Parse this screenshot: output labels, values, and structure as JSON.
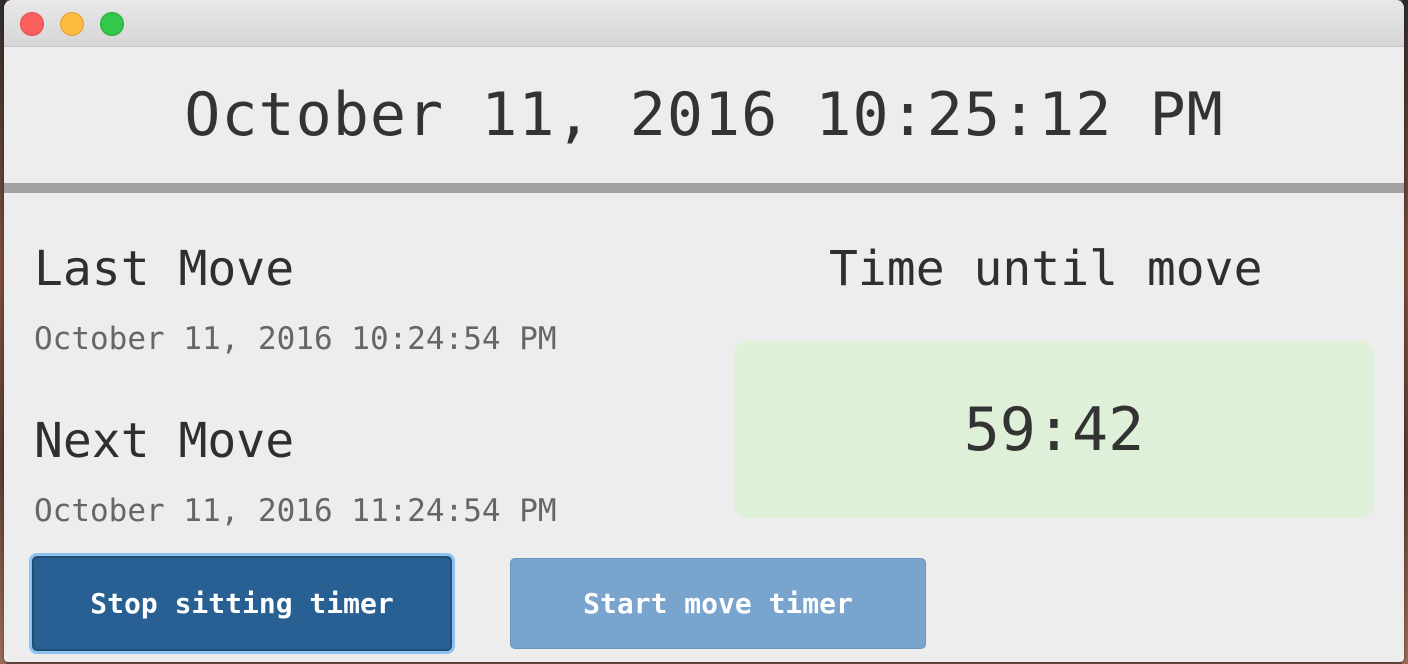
{
  "window": {
    "current_datetime": "October 11, 2016 10:25:12 PM"
  },
  "last_move": {
    "heading": "Last Move",
    "datetime": "October 11, 2016 10:24:54 PM"
  },
  "next_move": {
    "heading": "Next Move",
    "datetime": "October 11, 2016 11:24:54 PM"
  },
  "countdown": {
    "heading": "Time until move",
    "value": "59:42",
    "background_color": "#dff0d8"
  },
  "buttons": {
    "stop_label": "Stop sitting timer",
    "start_label": "Start move timer",
    "stop_color": "#286093",
    "start_color": "#78a4cd"
  },
  "icons": {
    "close": "close-icon",
    "minimize": "minimize-icon",
    "zoom": "zoom-icon"
  }
}
